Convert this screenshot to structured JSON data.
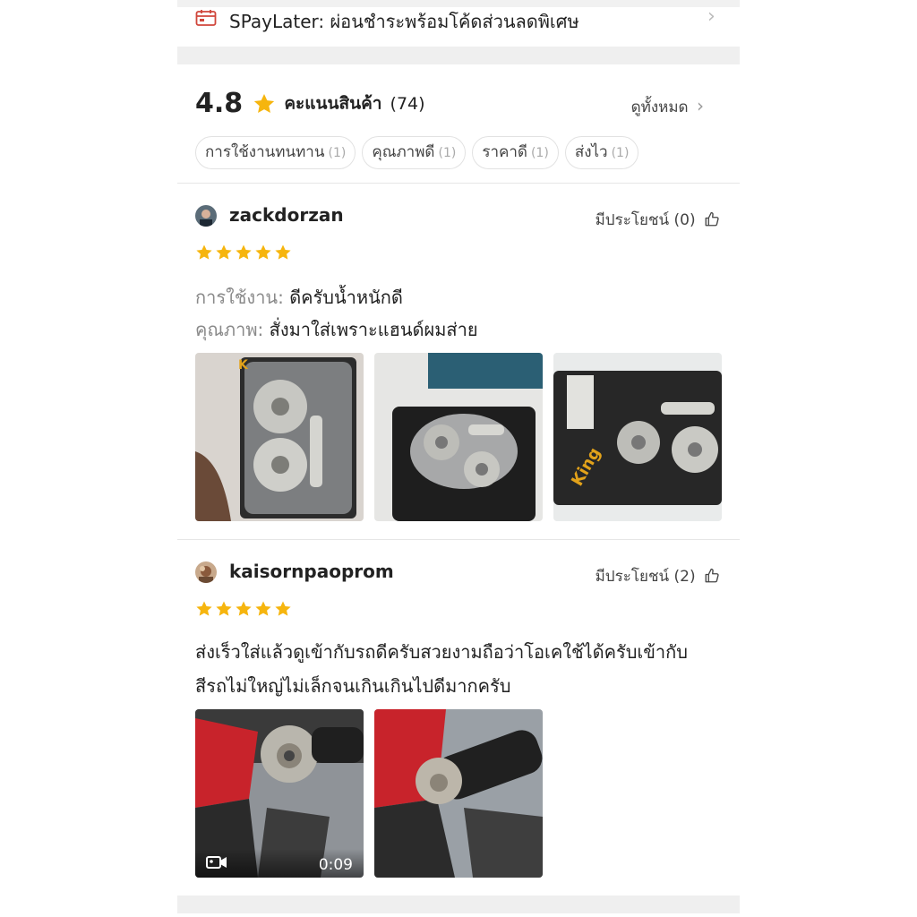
{
  "spaylater": {
    "text": "SPayLater: ผ่อนชำระพร้อมโค้ดส่วนลดพิเศษ",
    "icon": "calendar-card-icon"
  },
  "ratings": {
    "score": "4.8",
    "label": "คะแนนสินค้า",
    "count": "(74)",
    "view_all": "ดูทั้งหมด",
    "star_color": "#f6b50e",
    "filters": [
      {
        "label": "การใช้งานทนทาน",
        "count": "(1)"
      },
      {
        "label": "คุณภาพดี",
        "count": "(1)"
      },
      {
        "label": "ราคาดี",
        "count": "(1)"
      },
      {
        "label": "ส่งไว",
        "count": "(1)"
      }
    ]
  },
  "reviews": [
    {
      "username": "zackdorzan",
      "helpful": "มีประโยชน์ (0)",
      "rating": 5,
      "lines": [
        {
          "label": "การใช้งาน:",
          "text": "ดีครับน้ำหนักดี"
        },
        {
          "label": "คุณภาพ:",
          "text": "สั่งมาใส่เพราะแฮนด์ผมส่าย"
        }
      ],
      "photos": [
        "product-pack-photo-1",
        "product-pack-photo-2",
        "product-pack-photo-3"
      ]
    },
    {
      "username": "kaisornpaoprom",
      "helpful": "มีประโยชน์ (2)",
      "rating": 5,
      "lines": [
        {
          "text": "ส่งเร็วใส่แล้วดูเข้ากับรถดีครับสวยงามถือว่าโอเคใช้ได้ครับเข้ากับ"
        },
        {
          "text": "สีรถไม่ใหญ่ไม่เล็กจนเกินเกินไปดีมากครับ"
        }
      ],
      "media": [
        {
          "type": "video",
          "duration": "0:09"
        },
        {
          "type": "photo"
        }
      ]
    }
  ]
}
